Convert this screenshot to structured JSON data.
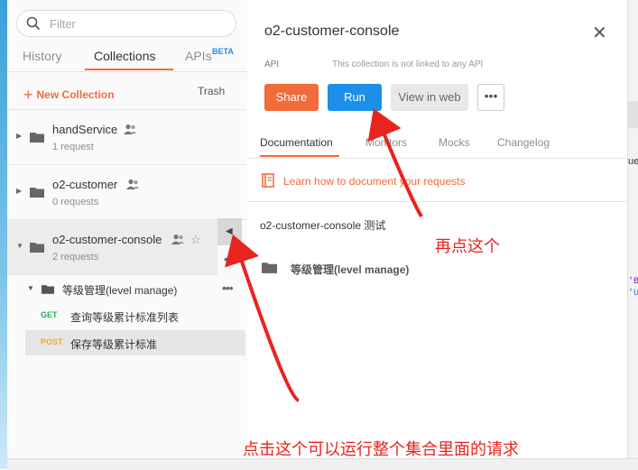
{
  "sidebar": {
    "search_placeholder": "Filter",
    "tabs": {
      "history": "History",
      "collections": "Collections",
      "apis": "APIs",
      "apis_badge": "BETA"
    },
    "new_collection": "New Collection",
    "trash": "Trash",
    "collections": [
      {
        "name": "handService",
        "count": "1 request"
      },
      {
        "name": "o2-customer",
        "count": "0 requests"
      },
      {
        "name": "o2-customer-console",
        "count": "2 requests"
      }
    ],
    "folder": {
      "name": "等级管理(level manage)"
    },
    "requests": [
      {
        "method": "GET",
        "name": "查询等级累计标准列表"
      },
      {
        "method": "POST",
        "name": "保存等级累计标准"
      }
    ]
  },
  "main": {
    "title": "o2-customer-console",
    "api_label": "API",
    "api_note": "This collection is not linked to any API",
    "buttons": {
      "share": "Share",
      "run": "Run",
      "view_web": "View in web",
      "more": "•••"
    },
    "tabs": {
      "documentation": "Documentation",
      "monitors": "Monitors",
      "mocks": "Mocks",
      "changelog": "Changelog"
    },
    "doc_link": "Learn how to document your requests",
    "description": "o2-customer-console 测试",
    "folder_name": "等级管理(level manage)"
  },
  "right_sliver": {
    "t1": "ue",
    "t2": "'B'.",
    "t3": "'U'"
  },
  "annotations": {
    "run_note": "再点这个",
    "collapse_note": "点击这个可以运行整个集合里面的请求"
  },
  "colors": {
    "accent": "#f26b3a",
    "run_blue": "#1d8fe8",
    "annotation_red": "#e8241e",
    "get_green": "#2aab5c",
    "post_yellow": "#f5a623"
  }
}
